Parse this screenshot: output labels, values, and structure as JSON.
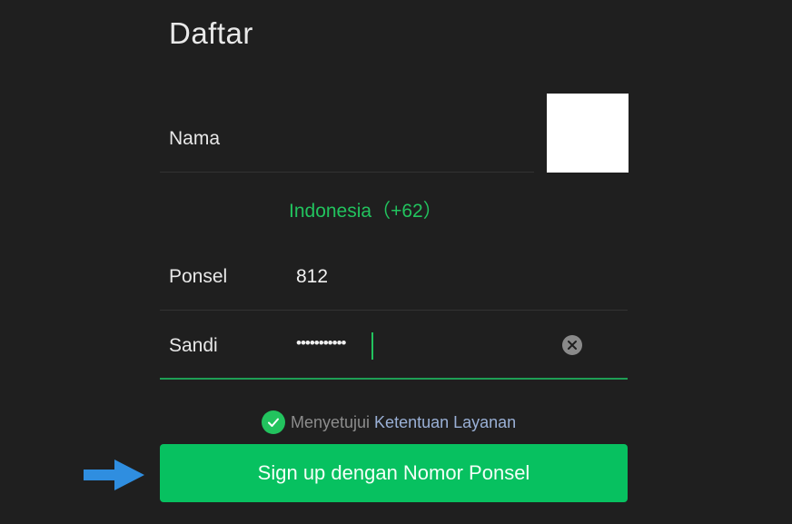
{
  "page": {
    "title": "Daftar"
  },
  "form": {
    "name_label": "Nama",
    "country": "Indonesia（+62）",
    "phone_label": "Ponsel",
    "phone_value": "812",
    "password_label": "Sandi",
    "password_value": "•••••••••••"
  },
  "agreement": {
    "text": "Menyetujui",
    "link": "Ketentuan Layanan"
  },
  "signup_button": {
    "label": "Sign up dengan Nomor Ponsel"
  },
  "colors": {
    "accent": "#07c160",
    "background": "#1f1f1f",
    "link": "#9ab0d6",
    "arrow": "#2f8ee0"
  },
  "icons": {
    "clear": "clear-icon",
    "check": "check-icon",
    "arrow": "arrow-right-icon"
  }
}
